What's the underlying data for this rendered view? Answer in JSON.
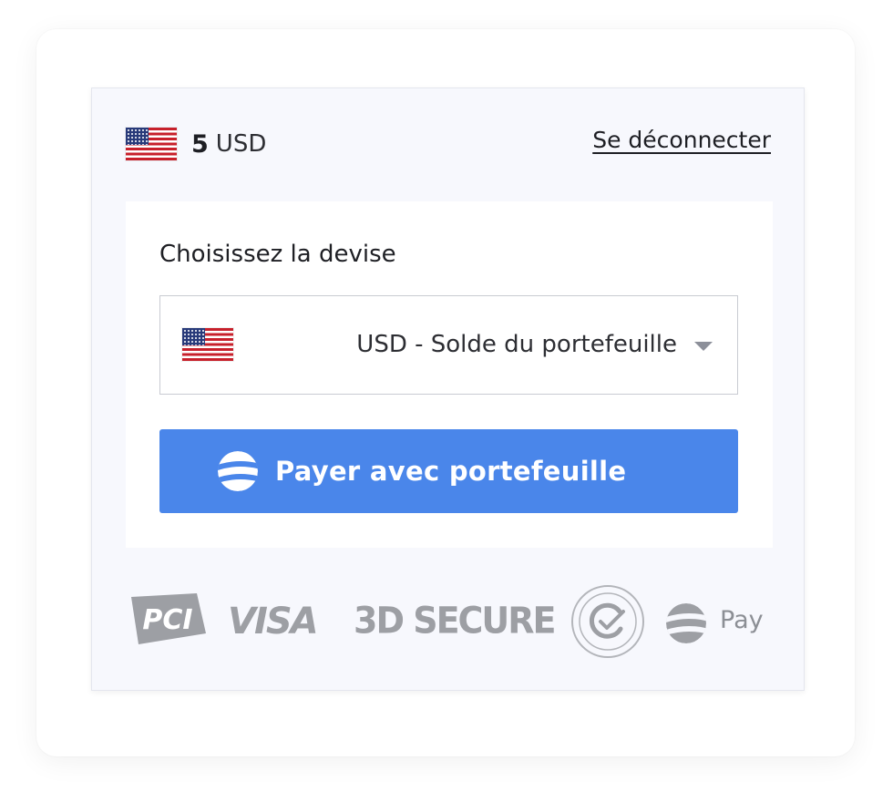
{
  "balance": {
    "flag_icon": "us-flag-icon",
    "amount": "5",
    "currency": "USD"
  },
  "header": {
    "logout_label": "Se déconnecter"
  },
  "panel": {
    "currency_label": "Choisissez la devise",
    "select": {
      "flag_icon": "us-flag-icon",
      "selected_value": "USD - Solde du portefeuille",
      "chevron_icon": "chevron-down-icon"
    },
    "pay_button": {
      "label": "Payer avec portefeuille",
      "icon": "wallet-brand-logo-icon"
    }
  },
  "badges": {
    "pci": "PCI",
    "visa": "VISA",
    "secure": "3D SECURE",
    "seal_icon": "certification-seal-icon",
    "pay_icon": "wallet-brand-logo-icon",
    "pay_label": "Pay"
  },
  "colors": {
    "primary_button": "#4a86ea",
    "widget_background": "#f7f8fd",
    "badge_gray": "#9d9fa4",
    "text_dark": "#1e1f24"
  }
}
